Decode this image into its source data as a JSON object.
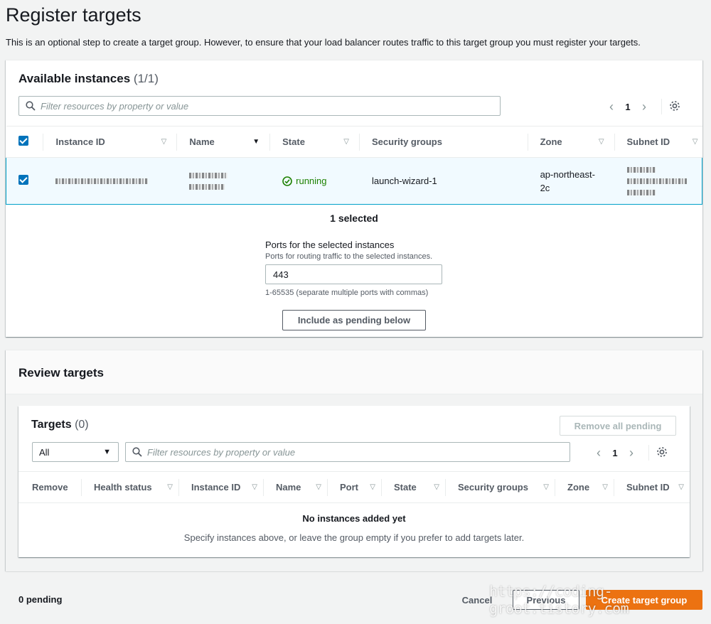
{
  "page": {
    "title": "Register targets",
    "description": "This is an optional step to create a target group. However, to ensure that your load balancer routes traffic to this target group you must register your targets."
  },
  "available": {
    "title": "Available instances",
    "count": "(1/1)",
    "filter_placeholder": "Filter resources by property or value",
    "page_number": "1",
    "columns": [
      "Instance ID",
      "Name",
      "State",
      "Security groups",
      "Zone",
      "Subnet ID"
    ],
    "row": {
      "state": "running",
      "security_group": "launch-wizard-1",
      "zone": "ap-northeast-2c"
    },
    "selected_text": "1 selected",
    "ports_label": "Ports for the selected instances",
    "ports_desc": "Ports for routing traffic to the selected instances.",
    "ports_value": "443",
    "ports_hint": "1-65535 (separate multiple ports with commas)",
    "include_button": "Include as pending below"
  },
  "review": {
    "title": "Review targets",
    "targets_title": "Targets",
    "targets_count": "(0)",
    "remove_all_button": "Remove all pending",
    "filter_select": "All",
    "filter_placeholder": "Filter resources by property or value",
    "page_number": "1",
    "columns": [
      "Remove",
      "Health status",
      "Instance ID",
      "Name",
      "Port",
      "State",
      "Security groups",
      "Zone",
      "Subnet ID"
    ],
    "empty_title": "No instances added yet",
    "empty_desc": "Specify instances above, or leave the group empty if you prefer to add targets later."
  },
  "footer": {
    "pending": "0 pending",
    "cancel": "Cancel",
    "previous": "Previous",
    "create": "Create target group",
    "watermark": "https://coding-groot.tistory.com"
  },
  "colors": {
    "primary": "#ec7211",
    "selection": "#0073bb",
    "running": "#1d8102"
  }
}
